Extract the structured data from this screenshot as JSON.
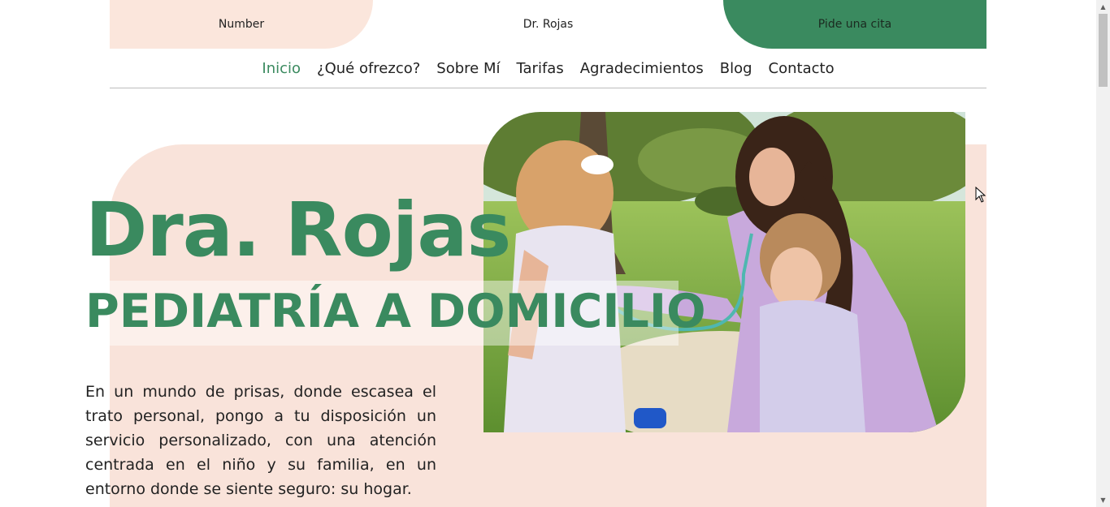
{
  "topbar": {
    "left_label": "Number",
    "center_label": "Dr. Rojas",
    "cta_label": "Pide una cita"
  },
  "nav": {
    "items": [
      {
        "label": "Inicio",
        "active": true
      },
      {
        "label": "¿Qué ofrezco?",
        "active": false
      },
      {
        "label": "Sobre Mí",
        "active": false
      },
      {
        "label": "Tarifas",
        "active": false
      },
      {
        "label": "Agradecimientos",
        "active": false
      },
      {
        "label": "Blog",
        "active": false
      },
      {
        "label": "Contacto",
        "active": false
      }
    ]
  },
  "hero": {
    "title": "Dra. Rojas",
    "subtitle": "PEDIATRÍA A DOMICILIO",
    "intro": "En un mundo de prisas, donde escasea el trato personal, pongo a tu disposición un servicio personalizado, con una atención centrada en el niño y su familia, en un entorno donde se siente seguro: su hogar.",
    "photo_icon": "pediatrician-with-children-photo"
  },
  "colors": {
    "brand_green": "#3a8a5f",
    "peach": "#f9e3da"
  },
  "scrollbar": {
    "up_icon": "arrow-up-icon",
    "down_icon": "arrow-down-icon"
  }
}
